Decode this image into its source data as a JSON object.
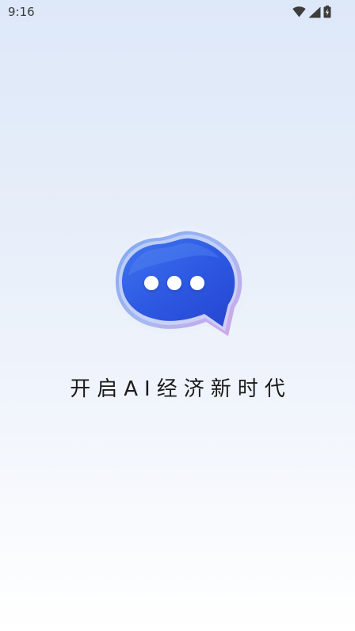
{
  "status_bar": {
    "time": "9:16",
    "icons": [
      "wifi-icon",
      "signal-icon",
      "battery-icon"
    ]
  },
  "splash": {
    "logo_icon": "chat-bubble-icon",
    "tagline": "开启AI经济新时代"
  },
  "colors": {
    "brand_blue": "#2f5be6",
    "background_top": "#dde8f9",
    "background_bottom": "#ffffff"
  }
}
